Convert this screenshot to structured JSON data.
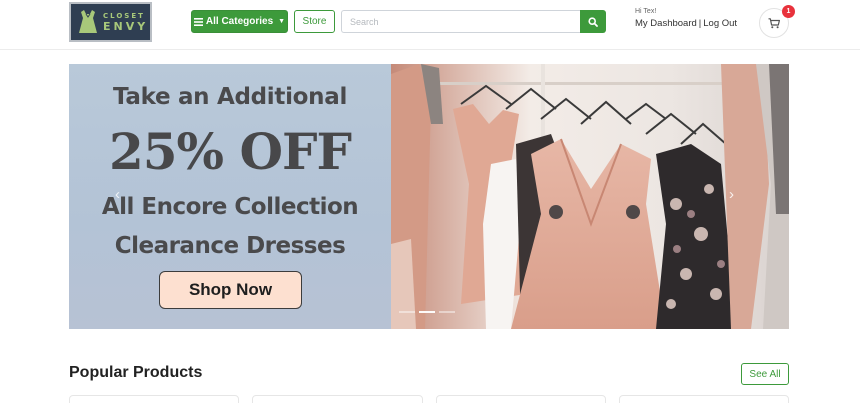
{
  "header": {
    "logo": {
      "line1": "CLOSET",
      "line2": "ENVY"
    },
    "categories_button": {
      "icon": "bars-icon",
      "label": "All Categories"
    },
    "store_button": {
      "label": "Store"
    },
    "search": {
      "placeholder": "Search",
      "value": "",
      "icon": "search-icon"
    },
    "account": {
      "greeting": "Hi Tex!",
      "dashboard_link": "My Dashboard",
      "separator": "|",
      "logout_link": "Log Out"
    },
    "cart": {
      "icon": "cart-icon",
      "count": "1"
    }
  },
  "hero": {
    "line1": "Take an Additional",
    "line2": "25% OFF",
    "line3": "All Encore Collection",
    "line4": "Clearance Dresses",
    "cta_label": "Shop Now",
    "prev_icon": "chevron-left-icon",
    "next_icon": "chevron-right-icon",
    "slides": 3,
    "active_slide": 1
  },
  "popular": {
    "title": "Popular Products",
    "see_all_label": "See All"
  },
  "colors": {
    "brand_green": "#3d9a3b",
    "logo_bg": "#2f3e52",
    "badge_red": "#e8323c",
    "cta_bg": "#fde0d0",
    "hero_bg": "#b9c9d9"
  }
}
